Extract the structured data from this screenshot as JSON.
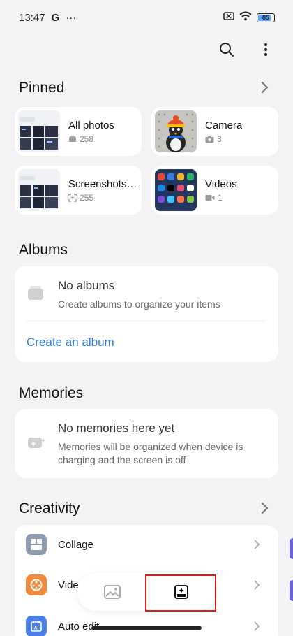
{
  "status_bar": {
    "time": "13:47",
    "carrier_glyph": "G",
    "more_glyph": "···",
    "battery": "85",
    "battery_level": 0.85
  },
  "header": {
    "search_icon": "search-icon",
    "more_icon": "more-vertical-icon"
  },
  "pinned": {
    "title": "Pinned",
    "items": [
      {
        "name": "All photos",
        "count": "258",
        "icon": "album-icon"
      },
      {
        "name": "Camera",
        "count": "3",
        "icon": "camera-icon"
      },
      {
        "name": "Screenshots ...",
        "count": "255",
        "icon": "screenshot-icon"
      },
      {
        "name": "Videos",
        "count": "1",
        "icon": "video-icon"
      }
    ]
  },
  "albums": {
    "title": "Albums",
    "empty_title": "No albums",
    "empty_desc": "Create albums to organize your items",
    "create_link": "Create an album"
  },
  "memories": {
    "title": "Memories",
    "empty_title": "No memories here yet",
    "empty_desc": "Memories will be organized when device is charging and the screen is off"
  },
  "creativity": {
    "title": "Creativity",
    "items": [
      {
        "label": "Collage",
        "color": "#8e9bb0"
      },
      {
        "label": "Vide",
        "color": "#f08a3c"
      },
      {
        "label": "Auto edit",
        "color": "#4a7fe8"
      }
    ]
  },
  "bottom_nav": {
    "photos_icon": "photos-tab-icon",
    "collections_icon": "collections-tab-icon"
  },
  "colors": {
    "accent": "#2f7fd8",
    "highlight": "#d62020",
    "background": "#f3f3f5"
  }
}
